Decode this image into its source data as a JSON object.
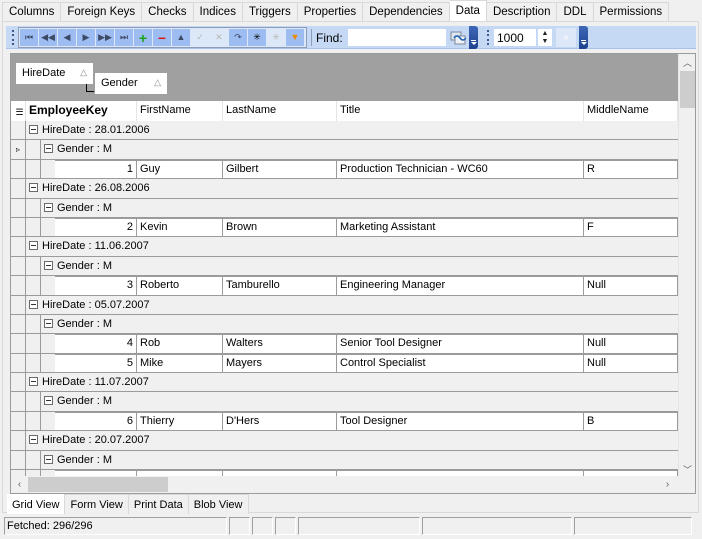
{
  "tabs": [
    {
      "label": "Columns",
      "active": false
    },
    {
      "label": "Foreign Keys",
      "active": false
    },
    {
      "label": "Checks",
      "active": false
    },
    {
      "label": "Indices",
      "active": false
    },
    {
      "label": "Triggers",
      "active": false
    },
    {
      "label": "Properties",
      "active": false
    },
    {
      "label": "Dependencies",
      "active": false
    },
    {
      "label": "Data",
      "active": true
    },
    {
      "label": "Description",
      "active": false
    },
    {
      "label": "DDL",
      "active": false
    },
    {
      "label": "Permissions",
      "active": false
    }
  ],
  "toolbar": {
    "nav_buttons": [
      {
        "name": "first-record",
        "glyph": "⏮",
        "state": "enabled"
      },
      {
        "name": "prior-page",
        "glyph": "◀◀",
        "state": "enabled"
      },
      {
        "name": "prior-record",
        "glyph": "◀",
        "state": "enabled"
      },
      {
        "name": "next-record",
        "glyph": "▶",
        "state": "enabled"
      },
      {
        "name": "next-page",
        "glyph": "▶▶",
        "state": "enabled"
      },
      {
        "name": "last-record",
        "glyph": "⏭",
        "state": "enabled"
      },
      {
        "name": "insert-record",
        "glyph": "+",
        "state": "enabled"
      },
      {
        "name": "delete-record",
        "glyph": "−",
        "state": "enabled"
      },
      {
        "name": "edit-record",
        "glyph": "▲",
        "state": "enabled"
      },
      {
        "name": "post-edit",
        "glyph": "✓",
        "state": "disabled"
      },
      {
        "name": "cancel-edit",
        "glyph": "✕",
        "state": "disabled"
      },
      {
        "name": "refresh",
        "glyph": "↷",
        "state": "enabled"
      },
      {
        "name": "set-null",
        "glyph": "✳",
        "state": "enabled"
      },
      {
        "name": "clear-null",
        "glyph": "✳",
        "state": "disabled"
      },
      {
        "name": "filter",
        "glyph": "▼",
        "state": "enabled"
      }
    ],
    "find_label": "Find:",
    "find_value": "",
    "record_limit": "1000",
    "next_glyph": "»"
  },
  "grid": {
    "group_by": [
      {
        "label": "HireDate",
        "sort_glyph": "△"
      },
      {
        "label": "Gender",
        "sort_glyph": "△"
      }
    ],
    "columns": [
      "EmployeeKey",
      "FirstName",
      "LastName",
      "Title",
      "MiddleName"
    ],
    "current_row_glyph": "▹",
    "groups": [
      {
        "label": "HireDate : 28.01.2006",
        "subgroups": [
          {
            "label": "Gender : M",
            "rows": [
              {
                "EmployeeKey": "1",
                "FirstName": "Guy",
                "LastName": "Gilbert",
                "Title": "Production Technician - WC60",
                "MiddleName": "R"
              }
            ]
          }
        ]
      },
      {
        "label": "HireDate : 26.08.2006",
        "subgroups": [
          {
            "label": "Gender : M",
            "rows": [
              {
                "EmployeeKey": "2",
                "FirstName": "Kevin",
                "LastName": "Brown",
                "Title": "Marketing Assistant",
                "MiddleName": "F"
              }
            ]
          }
        ]
      },
      {
        "label": "HireDate : 11.06.2007",
        "subgroups": [
          {
            "label": "Gender : M",
            "rows": [
              {
                "EmployeeKey": "3",
                "FirstName": "Roberto",
                "LastName": "Tamburello",
                "Title": "Engineering Manager",
                "MiddleName": "Null"
              }
            ]
          }
        ]
      },
      {
        "label": "HireDate : 05.07.2007",
        "subgroups": [
          {
            "label": "Gender : M",
            "rows": [
              {
                "EmployeeKey": "4",
                "FirstName": "Rob",
                "LastName": "Walters",
                "Title": "Senior Tool Designer",
                "MiddleName": "Null"
              },
              {
                "EmployeeKey": "5",
                "FirstName": "Mike",
                "LastName": "Mayers",
                "Title": "Control Specialist",
                "MiddleName": "Null"
              }
            ]
          }
        ]
      },
      {
        "label": "HireDate : 11.07.2007",
        "subgroups": [
          {
            "label": "Gender : M",
            "rows": [
              {
                "EmployeeKey": "6",
                "FirstName": "Thierry",
                "LastName": "D'Hers",
                "Title": "Tool Designer",
                "MiddleName": "B"
              }
            ]
          }
        ]
      },
      {
        "label": "HireDate : 20.07.2007",
        "subgroups": [
          {
            "label": "Gender : M",
            "rows": [
              {
                "EmployeeKey": "",
                "FirstName": "",
                "LastName": "",
                "Title": "",
                "MiddleName": ""
              }
            ]
          }
        ]
      }
    ]
  },
  "bottom_tabs": [
    {
      "label": "Grid View",
      "active": true
    },
    {
      "label": "Form View",
      "active": false
    },
    {
      "label": "Print Data",
      "active": false
    },
    {
      "label": "Blob View",
      "active": false
    }
  ],
  "status": {
    "fetched": "Fetched: 296/296"
  }
}
